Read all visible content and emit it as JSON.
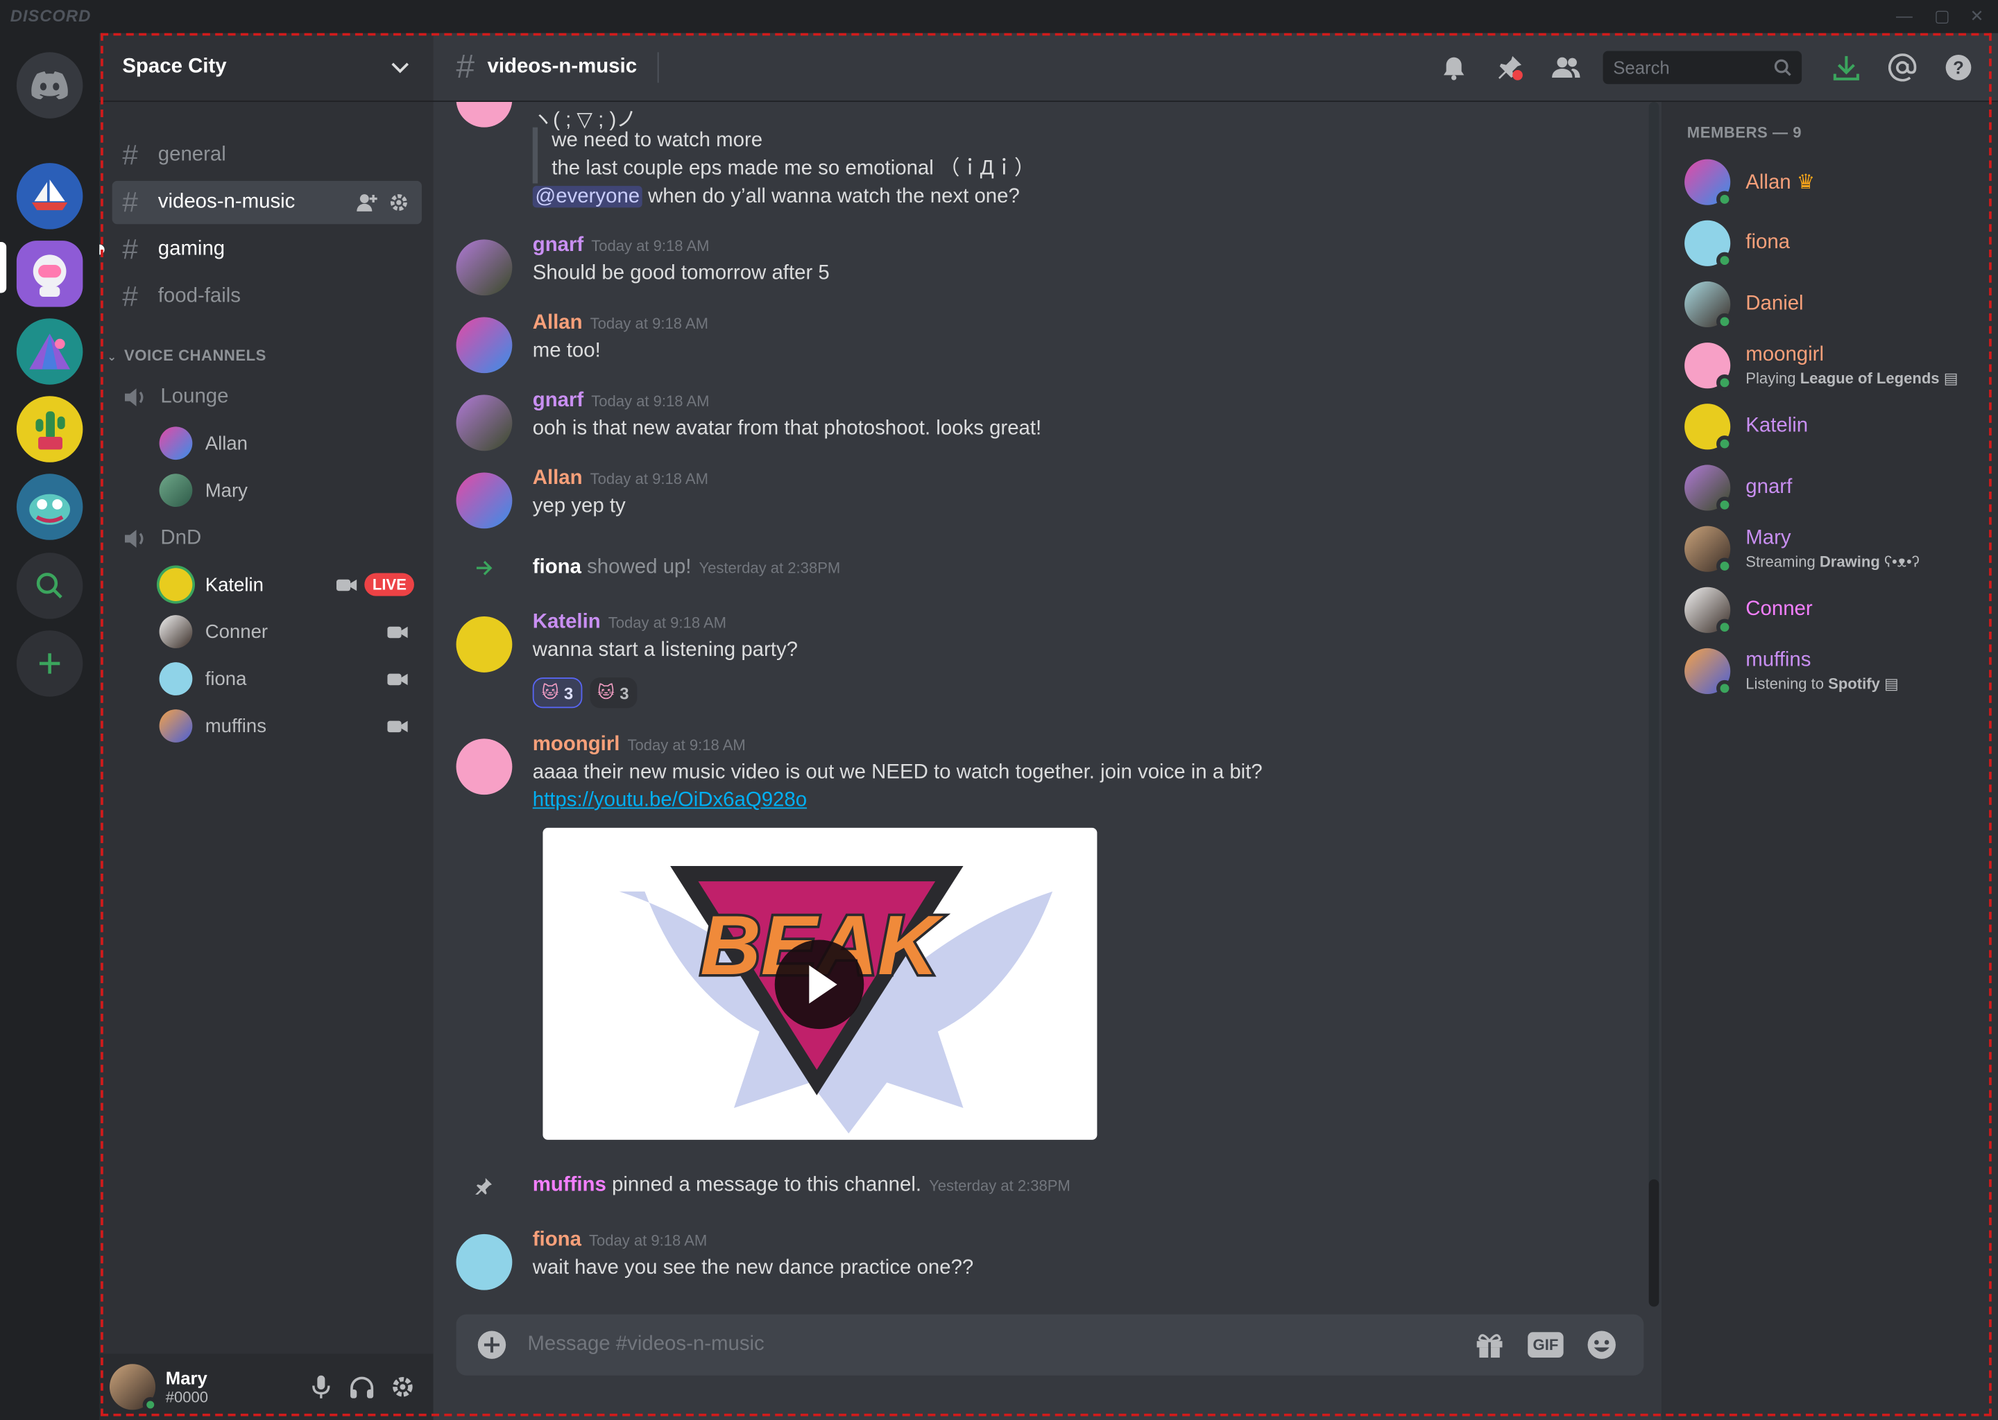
{
  "app": {
    "wordmark": "DISCORD"
  },
  "server": {
    "name": "Space City"
  },
  "channels": [
    {
      "name": "general"
    },
    {
      "name": "videos-n-music"
    },
    {
      "name": "gaming"
    },
    {
      "name": "food-fails"
    }
  ],
  "voice": {
    "category": "VOICE CHANNELS",
    "channels": [
      {
        "name": "Lounge",
        "users": [
          "Allan",
          "Mary"
        ]
      },
      {
        "name": "DnD",
        "users": [
          "Katelin",
          "Conner",
          "fiona",
          "muffins"
        ]
      }
    ],
    "live_badge": "LIVE"
  },
  "user_panel": {
    "name": "Mary",
    "tag": "#0000"
  },
  "chat": {
    "channel": "videos-n-music",
    "search_placeholder": "Search",
    "top_lines": [
      "ヽ( ; ▽ ; )ノ",
      "we need to watch more",
      "the last couple eps made me so emotional （ｉДｉ）"
    ],
    "mention": "@everyone",
    "mention_rest": " when do y’all wanna watch the next one?",
    "messages": [
      {
        "user": "gnarf",
        "ts": "Today at 9:18 AM",
        "text": "Should be good tomorrow after 5",
        "color": "#c98ff2"
      },
      {
        "user": "Allan",
        "ts": "Today at 9:18 AM",
        "text": "me too!",
        "color": "#f7a07a"
      },
      {
        "user": "gnarf",
        "ts": "Today at 9:18 AM",
        "text": "ooh is that new avatar from that photoshoot. looks great!",
        "color": "#c98ff2"
      },
      {
        "user": "Allan",
        "ts": "Today at 9:18 AM",
        "text": "yep yep ty",
        "color": "#f7a07a"
      },
      {
        "user": "Katelin",
        "ts": "Today at 9:18 AM",
        "text": "wanna start a listening party?",
        "color": "#c98ff2"
      },
      {
        "user": "moongirl",
        "ts": "Today at 9:18 AM",
        "text": "aaaa their new music video is out we NEED to watch together. join voice in a bit?",
        "color": "#f7a07a"
      },
      {
        "user": "fiona",
        "ts": "Today at 9:18 AM",
        "text": "wait have you see the new dance practice one??",
        "color": "#f7a07a"
      }
    ],
    "join": {
      "user": "fiona",
      "text": "showed up!",
      "ts": "Yesterday at 2:38PM"
    },
    "pin": {
      "user": "muffins",
      "text": "pinned a message to this channel.",
      "ts": "Yesterday at 2:38PM"
    },
    "reactions": [
      {
        "count": "3"
      },
      {
        "count": "3"
      }
    ],
    "link": "https://youtu.be/OiDx6aQ928o",
    "embed_logo": "BEAK",
    "composer_placeholder": "Message #videos-n-music",
    "gif_label": "GIF"
  },
  "members": {
    "header": "MEMBERS — 9",
    "list": [
      {
        "name": "Allan",
        "color": "#f7a07a"
      },
      {
        "name": "fiona",
        "color": "#f7a07a"
      },
      {
        "name": "Daniel",
        "color": "#f7a07a"
      },
      {
        "name": "moongirl",
        "color": "#f7a07a",
        "act_prefix": "Playing ",
        "act_bold": "League of Legends"
      },
      {
        "name": "Katelin",
        "color": "#c98ff2"
      },
      {
        "name": "gnarf",
        "color": "#c98ff2"
      },
      {
        "name": "Mary",
        "color": "#c98ff2",
        "act_prefix": "Streaming ",
        "act_bold": "Drawing",
        "act_suffix": " ʕ•ᴥ•ʔ"
      },
      {
        "name": "Conner",
        "color": "#f47fff"
      },
      {
        "name": "muffins",
        "color": "#c98ff2",
        "act_prefix": "Listening to ",
        "act_bold": "Spotify"
      }
    ]
  },
  "colors": {
    "accent": "#5865f2",
    "online": "#3ba55d",
    "live": "#ed4245",
    "pin_user": "#f47fff"
  }
}
